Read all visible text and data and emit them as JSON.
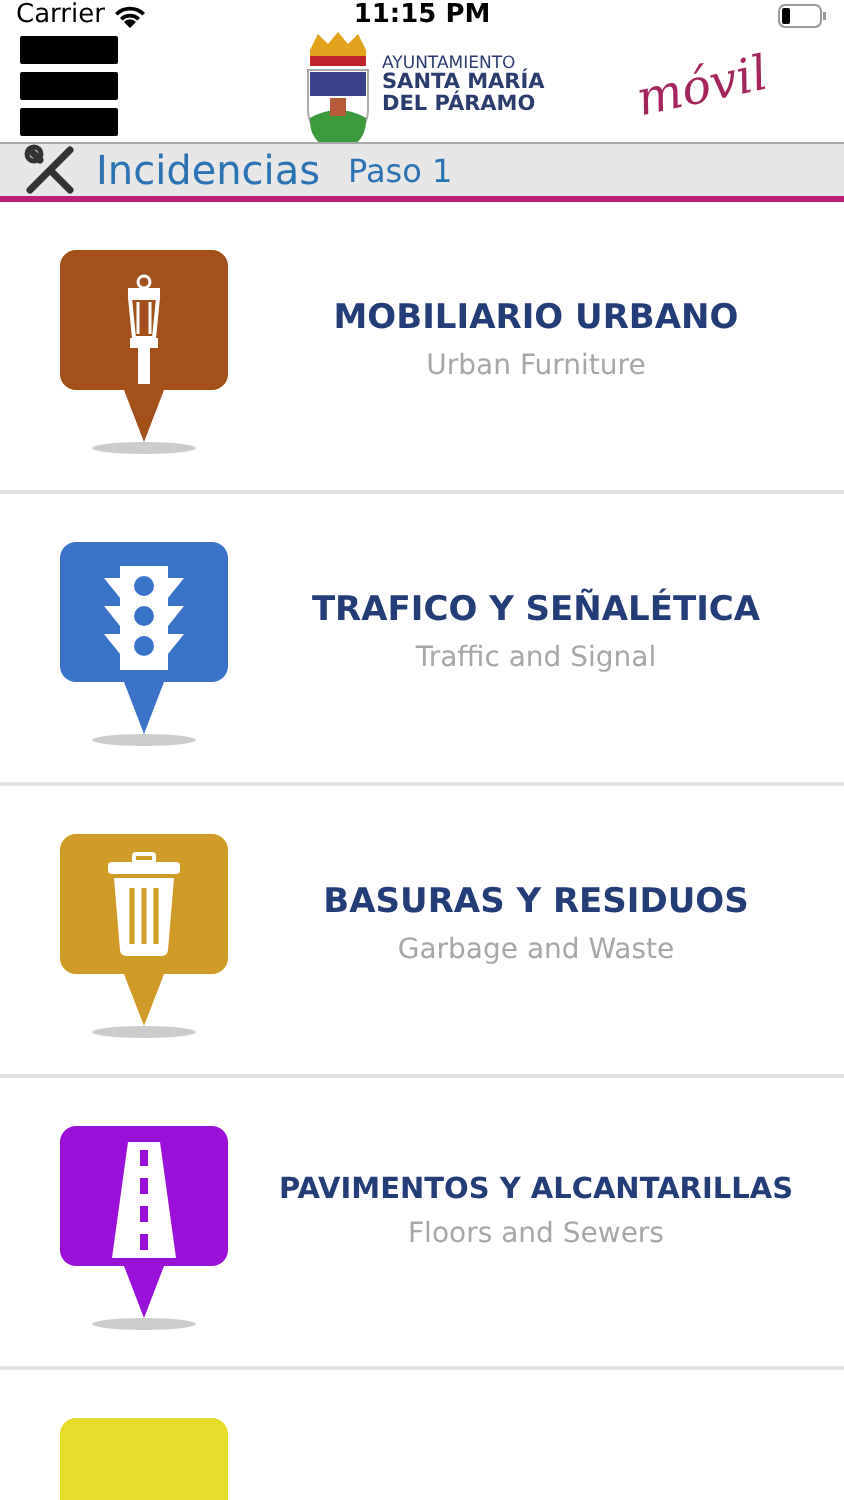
{
  "status_bar": {
    "carrier": "Carrier",
    "time": "11:15 PM"
  },
  "header": {
    "logo_lines": [
      "AYUNTAMIENTO",
      "SANTA MARÍA",
      "DEL PÁRAMO"
    ],
    "tagline": "móvil"
  },
  "section": {
    "title": "Incidencias",
    "step": "Paso 1"
  },
  "categories": [
    {
      "kind": "lamp",
      "color": "#a4501a",
      "title": "MOBILIARIO URBANO",
      "subtitle": "Urban Furniture"
    },
    {
      "kind": "traffic",
      "color": "#3a72c8",
      "title": "TRAFICO Y SEÑALÉTICA",
      "subtitle": "Traffic and Signal"
    },
    {
      "kind": "trash",
      "color": "#d09a26",
      "title": "BASURAS Y RESIDUOS",
      "subtitle": "Garbage and Waste"
    },
    {
      "kind": "road",
      "color": "#9a10d8",
      "title": "PAVIMENTOS Y ALCANTARILLAS",
      "subtitle": "Floors and Sewers"
    },
    {
      "kind": "none",
      "color": "#e8dc2a"
    }
  ]
}
